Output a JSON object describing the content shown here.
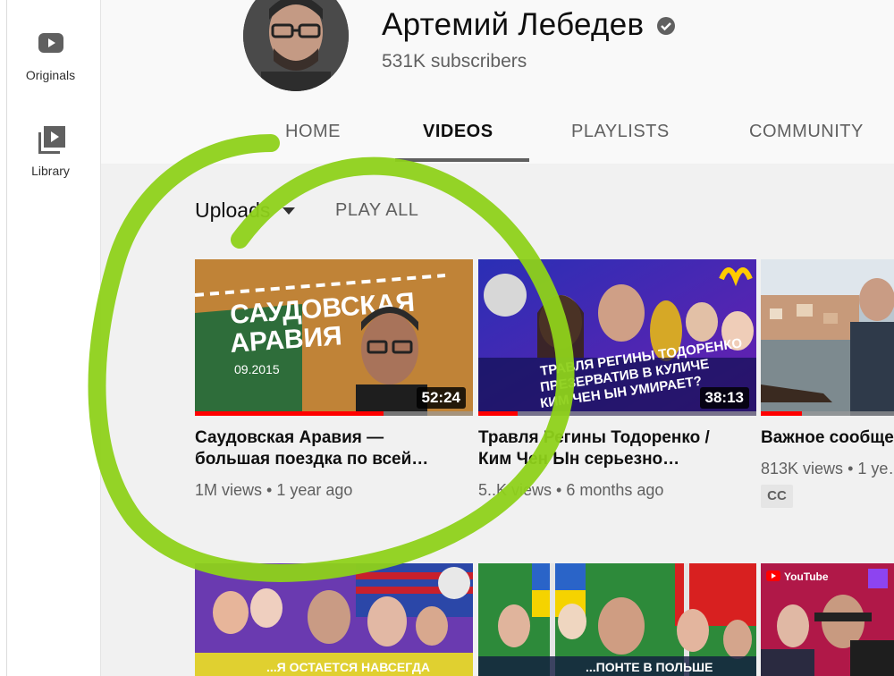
{
  "sidebar": {
    "items": [
      {
        "label": "Originals",
        "icon": "youtube-play-icon"
      },
      {
        "label": "Library",
        "icon": "library-icon"
      }
    ]
  },
  "channel": {
    "name": "Артемий Лебедев",
    "subscribers": "531K subscribers",
    "verified": true
  },
  "tabs": [
    {
      "label": "HOME",
      "active": false
    },
    {
      "label": "VIDEOS",
      "active": true
    },
    {
      "label": "PLAYLISTS",
      "active": false
    },
    {
      "label": "COMMUNITY",
      "active": false
    }
  ],
  "toolbar": {
    "sort_label": "Uploads",
    "play_all": "PLAY ALL"
  },
  "videos": [
    {
      "thumb_text_1": "САУДОВСКАЯ",
      "thumb_text_2": "АРАВИЯ",
      "thumb_date": "09.2015",
      "duration": "52:24",
      "title": "Саудовская Аравия — большая поездка по всей…",
      "views": "1M views",
      "age": "1 year ago",
      "watched_fraction": 0.68
    },
    {
      "thumb_text_1": "ТРАВЛЯ РЕГИНЫ ТОДОРЕНКО",
      "thumb_text_2": "ПРЕЗЕРВАТИВ В КУЛИЧЕ",
      "thumb_text_3": "КИМ ЧЕН ЫН УМИРАЕТ?",
      "duration": "38:13",
      "title": "Травля Регины Тодоренко / Ким Чен Ын серьезно…",
      "views": "5..K views",
      "age": "6 months ago",
      "watched_fraction": 0.14
    },
    {
      "title": "Важное сообще…",
      "views": "813K views",
      "age": "1 ye…",
      "badge": "CC",
      "watched_fraction": 0.31
    }
  ],
  "row2": [
    {
      "thumb_text": "...Я ОСТАЕТСЯ НАВСЕГДА"
    },
    {
      "thumb_text": "...ПОНТЕ В ПОЛЬШЕ"
    },
    {
      "thumb_text": "YouTube"
    }
  ],
  "colors": {
    "accent_red": "#ff0000",
    "annotation_green": "#8ed11a",
    "tab_active_underline": "#606060"
  }
}
